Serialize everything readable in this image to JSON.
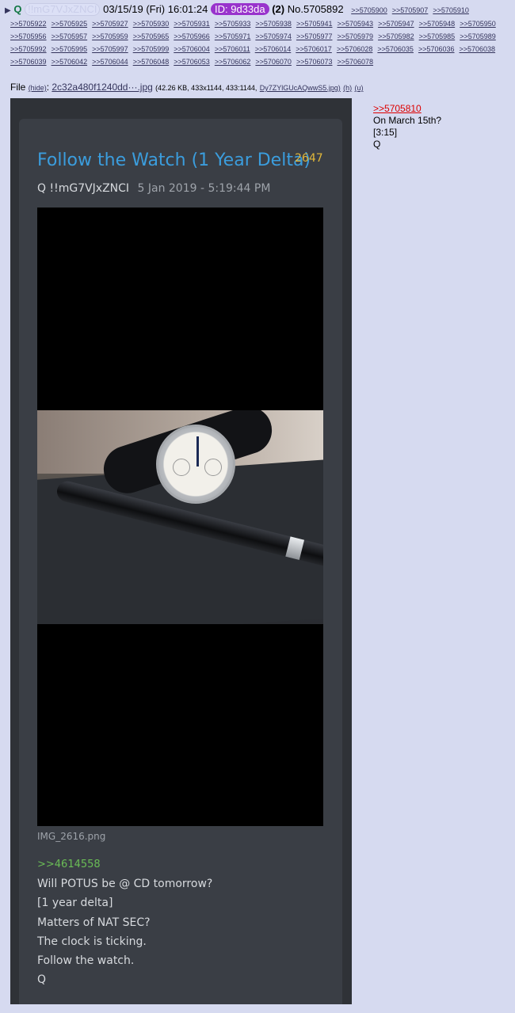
{
  "header": {
    "name": "Q",
    "tripcode": "!!mG7VJxZNCI",
    "datetime": "03/15/19 (Fri) 16:01:24",
    "id_label": "ID: 9d33da",
    "post_count": "(2)",
    "post_no": "No.5705892",
    "inline_backlinks": [
      ">>5705900",
      ">>5705907",
      ">>5705910"
    ]
  },
  "backlinks": [
    ">>5705922",
    ">>5705925",
    ">>5705927",
    ">>5705930",
    ">>5705931",
    ">>5705933",
    ">>5705938",
    ">>5705941",
    ">>5705943",
    ">>5705947",
    ">>5705948",
    ">>5705950",
    ">>5705956",
    ">>5705957",
    ">>5705959",
    ">>5705965",
    ">>5705966",
    ">>5705971",
    ">>5705974",
    ">>5705977",
    ">>5705979",
    ">>5705982",
    ">>5705985",
    ">>5705989",
    ">>5705992",
    ">>5705995",
    ">>5705997",
    ">>5705999",
    ">>5706004",
    ">>5706011",
    ">>5706014",
    ">>5706017",
    ">>5706028",
    ">>5706035",
    ">>5706036",
    ">>5706038",
    ">>5706039",
    ">>5706042",
    ">>5706044",
    ">>5706048",
    ">>5706053",
    ">>5706062",
    ">>5706070",
    ">>5706073",
    ">>5706078"
  ],
  "file": {
    "label": "File",
    "hide": "(hide)",
    "filename": "2c32a480f1240dd···.jpg",
    "info": "(42.26 KB, 433x1144, 433:1144,",
    "orig": "Dy7ZYlGUcAQwwS5.jpg)",
    "h": "(h)",
    "u": "(u)"
  },
  "embedded": {
    "title": "Follow the Watch (1 Year Delta)",
    "number": "2647",
    "author": "Q",
    "trip": "!!mG7VJxZNCI",
    "date": "5 Jan 2019 - 5:19:44 PM",
    "caption": "IMG_2616.png",
    "ref": ">>4614558",
    "lines": [
      "Will POTUS be @ CD tomorrow?",
      "[1 year delta]",
      "Matters of NAT SEC?",
      "The clock is ticking.",
      "Follow the watch.",
      "Q"
    ]
  },
  "reply": {
    "link": ">>5705810",
    "lines": [
      "On March 15th?",
      "[3:15]",
      "Q"
    ]
  }
}
